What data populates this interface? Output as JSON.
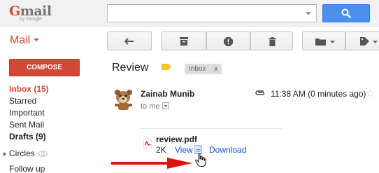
{
  "logo": {
    "g_letter": "G",
    "rest": "mail",
    "sub": "by Google"
  },
  "search": {
    "value": "",
    "placeholder": ""
  },
  "mail_menu": {
    "label": "Mail"
  },
  "toolbar": {
    "buttons": [
      {
        "icon": "back-arrow-icon"
      },
      {
        "icon": "archive-icon"
      },
      {
        "icon": "report-spam-icon"
      },
      {
        "icon": "trash-icon"
      },
      {
        "icon": "folder-move-icon"
      },
      {
        "icon": "label-tag-icon"
      }
    ]
  },
  "compose": {
    "label": "COMPOSE"
  },
  "nav": {
    "inbox": "Inbox (15)",
    "starred": "Starred",
    "important": "Important",
    "sent": "Sent Mail",
    "drafts": "Drafts (9)",
    "circles": "Circles",
    "follow_up": "Follow up"
  },
  "thread": {
    "subject": "Review",
    "label_chip": "Inbox",
    "label_remove": "x"
  },
  "message": {
    "sender": "Zainab Munib",
    "recipient": "to me",
    "time": "11:38 AM (0 minutes ago)",
    "star": "☆"
  },
  "attachment": {
    "name": "review.pdf",
    "size": "2K",
    "view_label": "View",
    "download_label": "Download"
  },
  "colors": {
    "brand_red": "#d14836",
    "search_blue": "#4d8fec",
    "link_blue": "#1155cc",
    "label_yellow": "#f4c431",
    "arrow_red": "#dd1111"
  }
}
